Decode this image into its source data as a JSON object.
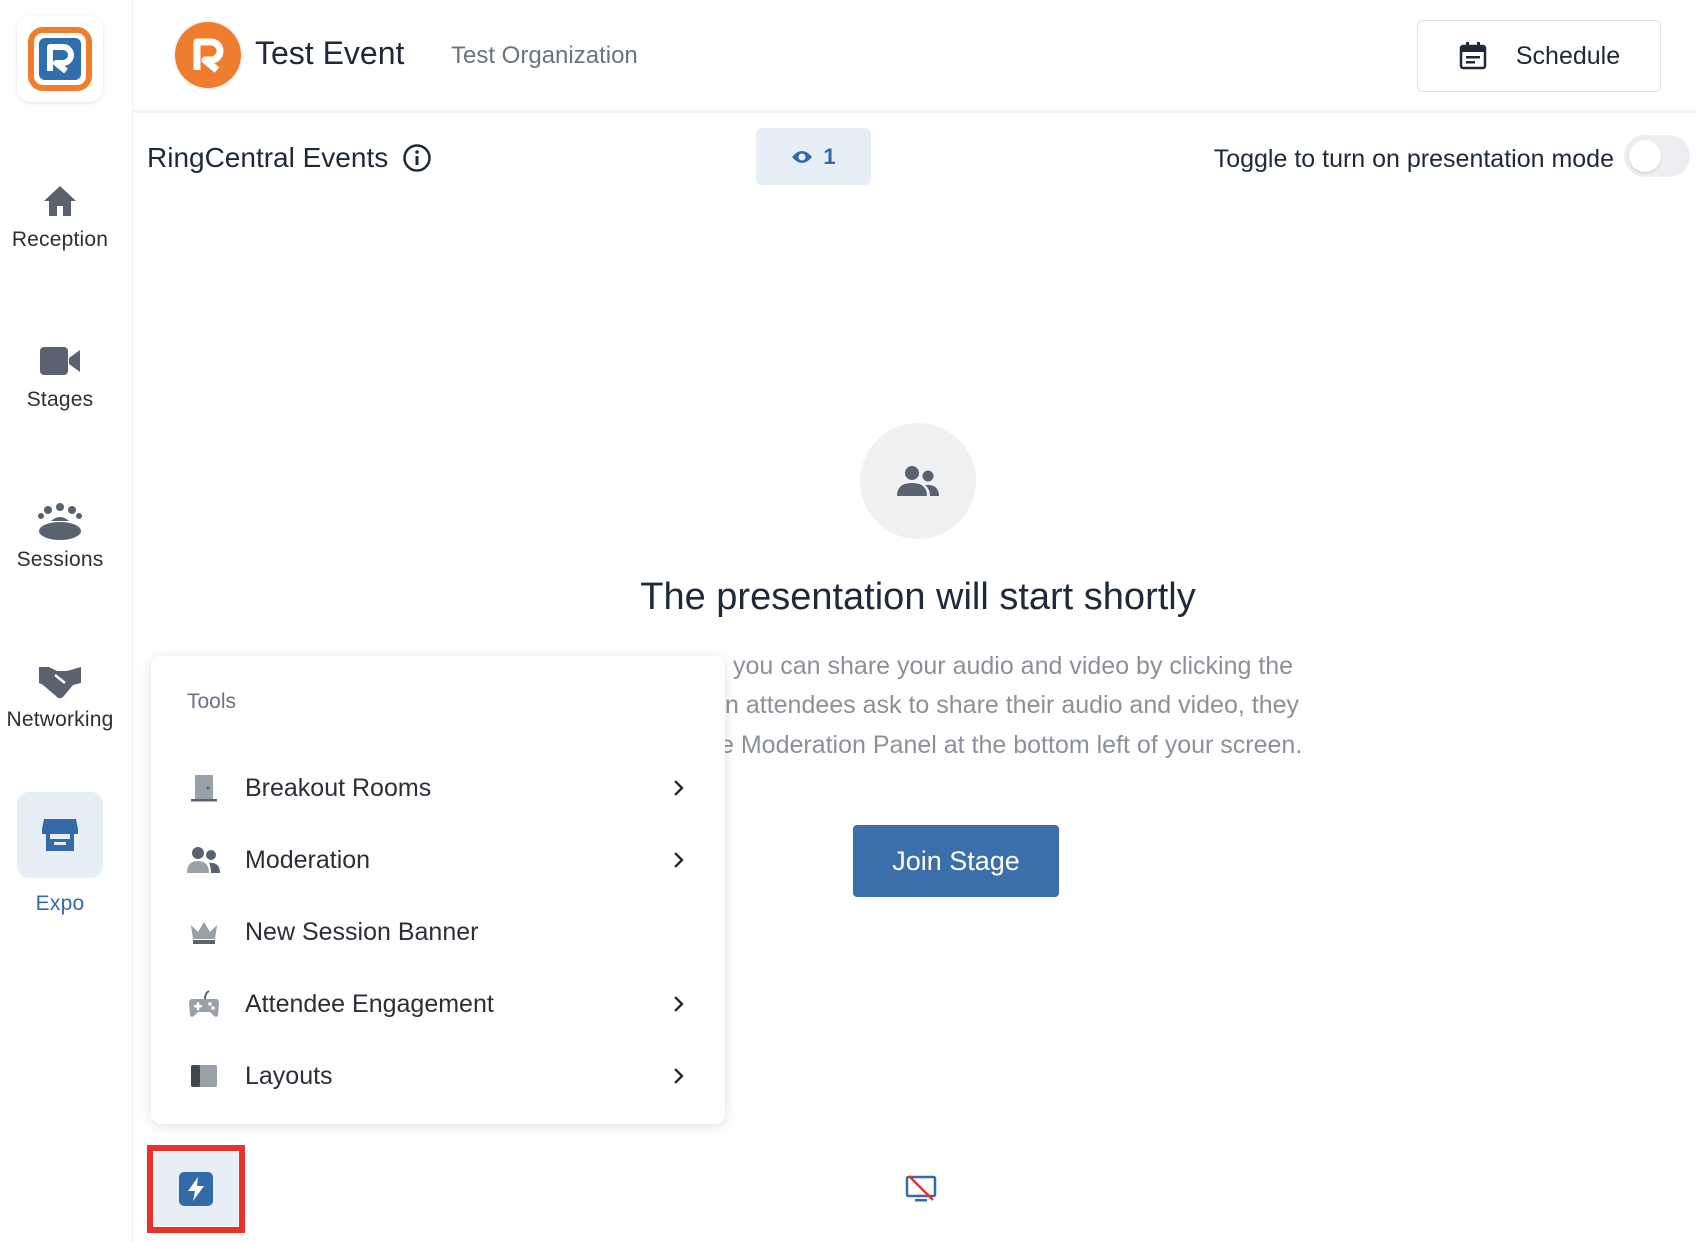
{
  "sidebar": {
    "items": [
      {
        "label": "Reception",
        "icon": "home-icon"
      },
      {
        "label": "Stages",
        "icon": "video-camera-icon"
      },
      {
        "label": "Sessions",
        "icon": "audience-icon"
      },
      {
        "label": "Networking",
        "icon": "handshake-icon"
      },
      {
        "label": "Expo",
        "icon": "booth-icon",
        "active": true
      }
    ]
  },
  "header": {
    "event_title": "Test Event",
    "organization": "Test Organization",
    "schedule_label": "Schedule"
  },
  "subheader": {
    "title": "RingCentral Events",
    "viewer_count": "1",
    "toggle_label": "Toggle to turn on presentation mode",
    "presentation_mode_on": false
  },
  "main": {
    "heading": "The presentation will start shortly",
    "description_lines": [
      "you can share your audio and video by clicking the",
      "n attendees ask to share their audio and video, they",
      "e Moderation Panel at the bottom left of your screen."
    ],
    "join_label": "Join Stage"
  },
  "tools": {
    "header": "Tools",
    "items": [
      {
        "label": "Breakout Rooms",
        "icon": "door-icon",
        "has_submenu": true
      },
      {
        "label": "Moderation",
        "icon": "users-icon",
        "has_submenu": true
      },
      {
        "label": "New Session Banner",
        "icon": "crown-icon",
        "has_submenu": false
      },
      {
        "label": "Attendee Engagement",
        "icon": "gamepad-icon",
        "has_submenu": true
      },
      {
        "label": "Layouts",
        "icon": "layout-icon",
        "has_submenu": true
      }
    ]
  },
  "colors": {
    "accent": "#336aa8",
    "brand_orange": "#ef7d2e",
    "highlight": "#e8322a"
  }
}
